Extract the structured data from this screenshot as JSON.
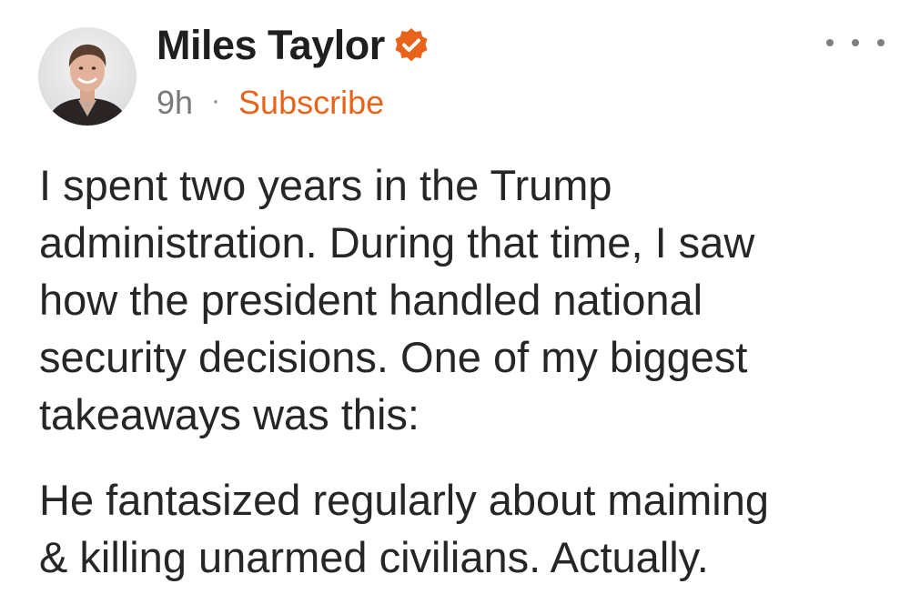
{
  "post": {
    "author": {
      "name": "Miles Taylor",
      "verified_icon": "verified-check-icon",
      "verified_color": "#e8641b"
    },
    "meta": {
      "time": "9h",
      "separator": "·",
      "subscribe_label": "Subscribe",
      "accent_color": "#e8641b"
    },
    "more_icon": "ellipsis-icon",
    "paragraphs": [
      {
        "lines": [
          "I spent two years in the Trump",
          "administration. During that time, I saw",
          "how the president handled national",
          "security decisions. One of my biggest",
          "takeaways was this:"
        ]
      },
      {
        "lines": [
          "He fantasized regularly about maiming",
          "& killing unarmed civilians. Actually."
        ]
      }
    ]
  }
}
